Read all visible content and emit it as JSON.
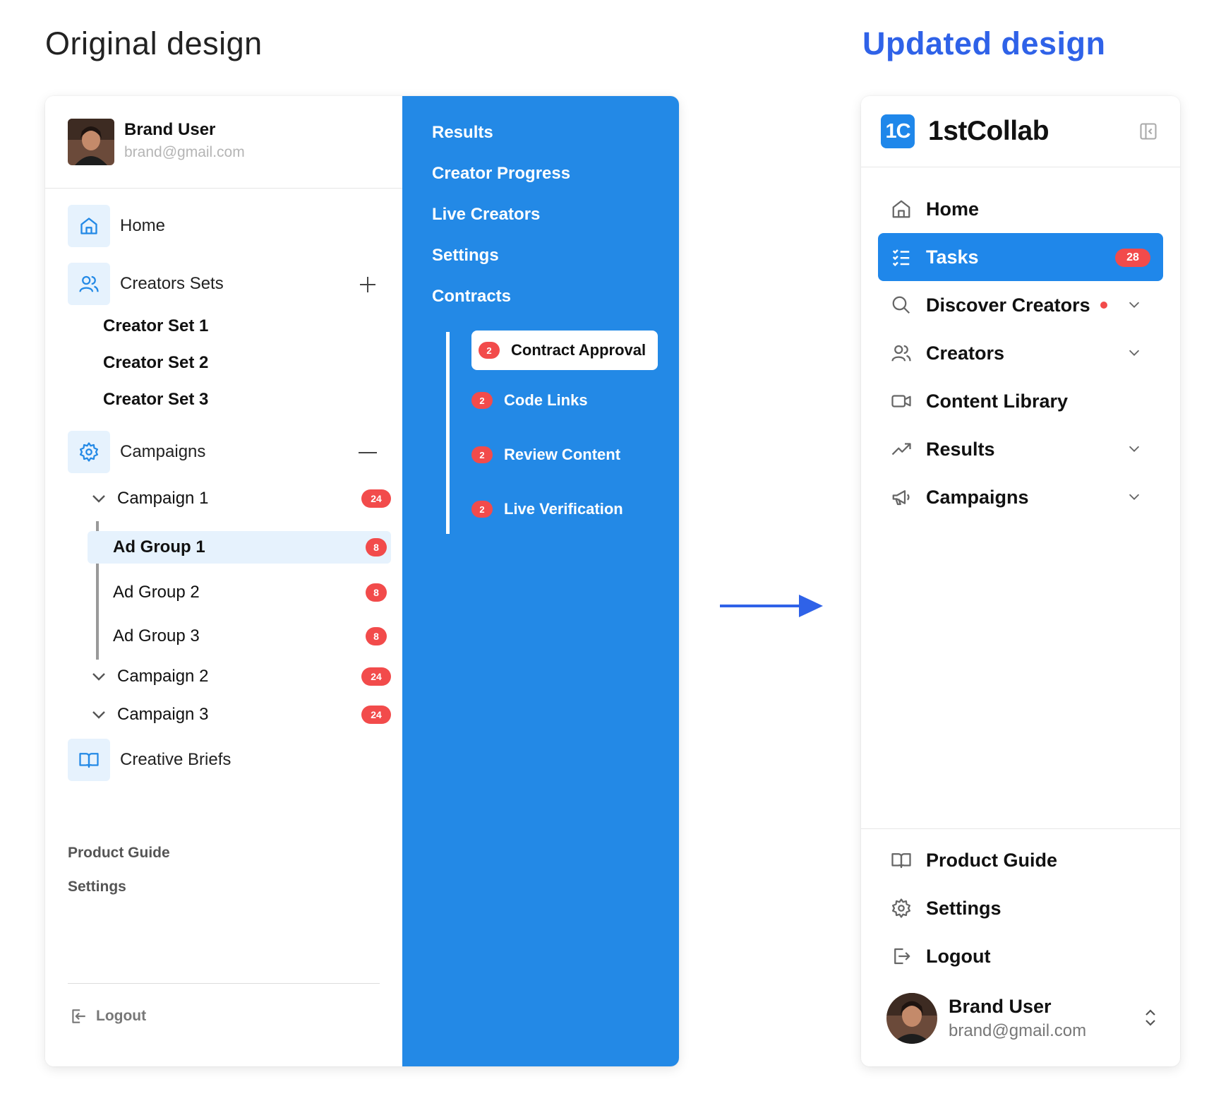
{
  "headings": {
    "original": "Original design",
    "updated": "Updated design"
  },
  "original": {
    "user": {
      "name": "Brand User",
      "email": "brand@gmail.com"
    },
    "nav": {
      "home": "Home",
      "creator_sets": "Creators Sets",
      "creator_set_items": [
        "Creator Set 1",
        "Creator Set 2",
        "Creator Set 3"
      ],
      "campaigns": "Campaigns",
      "campaign_items": [
        {
          "label": "Campaign 1",
          "badge": "24"
        },
        {
          "label": "Campaign 2",
          "badge": "24"
        },
        {
          "label": "Campaign 3",
          "badge": "24"
        }
      ],
      "ad_groups": [
        {
          "label": "Ad Group 1",
          "badge": "8"
        },
        {
          "label": "Ad Group 2",
          "badge": "8"
        },
        {
          "label": "Ad Group 3",
          "badge": "8"
        }
      ],
      "creative_briefs": "Creative Briefs",
      "product_guide": "Product Guide",
      "settings": "Settings",
      "logout": "Logout"
    },
    "submenu": {
      "items": [
        "Results",
        "Creator Progress",
        "Live Creators",
        "Settings",
        "Contracts"
      ],
      "contract_items": [
        {
          "label": "Contract Approval",
          "badge": "2"
        },
        {
          "label": "Code Links",
          "badge": "2"
        },
        {
          "label": "Review Content",
          "badge": "2"
        },
        {
          "label": "Live Verification",
          "badge": "2"
        }
      ]
    }
  },
  "updated": {
    "logo_mark": "1C",
    "brand": "1stCollab",
    "nav": {
      "home": "Home",
      "tasks": "Tasks",
      "tasks_badge": "28",
      "discover": "Discover Creators",
      "creators": "Creators",
      "content_library": "Content Library",
      "results": "Results",
      "campaigns": "Campaigns"
    },
    "footer": {
      "product_guide": "Product Guide",
      "settings": "Settings",
      "logout": "Logout"
    },
    "user": {
      "name": "Brand User",
      "email": "brand@gmail.com"
    }
  },
  "colors": {
    "accent": "#2389e6",
    "badge": "#f24b4b",
    "heading_blue": "#2f62e8",
    "icon_bg": "#e6f2fd"
  },
  "icons": [
    "home-icon",
    "users-icon",
    "plus-icon",
    "gear-icon",
    "minus-icon",
    "chevron-down-icon",
    "book-icon",
    "logout-icon",
    "arrow-right-icon",
    "collapse-sidebar-icon",
    "tasks-icon",
    "search-icon",
    "video-icon",
    "trending-icon",
    "megaphone-icon",
    "updown-icon"
  ]
}
